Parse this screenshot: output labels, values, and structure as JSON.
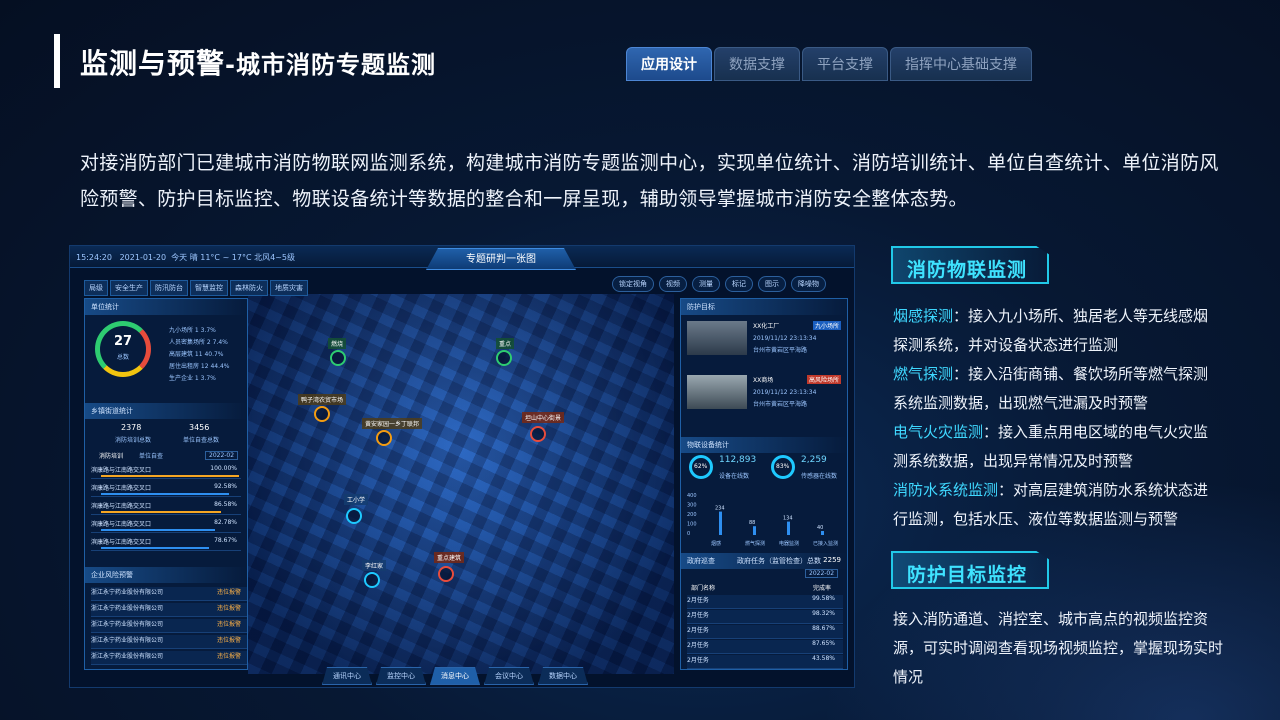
{
  "header": {
    "title_main": "监测与预警",
    "title_sub": "-城市消防专题监测"
  },
  "tabs": [
    {
      "label": "应用设计",
      "active": true
    },
    {
      "label": "数据支撑",
      "active": false
    },
    {
      "label": "平台支撑",
      "active": false
    },
    {
      "label": "指挥中心基础支撑",
      "active": false
    }
  ],
  "intro": "对接消防部门已建城市消防物联网监测系统，构建城市消防专题监测中心，实现单位统计、消防培训统计、单位自查统计、单位消防风险预警、防护目标监控、物联设备统计等数据的整合和一屏呈现，辅助领导掌握城市消防安全整体态势。",
  "dashboard": {
    "time": "15:24:20",
    "date": "2021-01-20",
    "weather": "今天 晴 11°C ~ 17°C 北风4~5级",
    "title": "专题研判一张图",
    "nav": [
      "局级",
      "安全生产",
      "防汛防台",
      "智慧监控",
      "森林防火",
      "地质灾害"
    ],
    "tools": [
      "锁定视角",
      "视频",
      "测量",
      "标记",
      "图示",
      "降噪物"
    ],
    "left": {
      "unit_stats_title": "单位统计",
      "ring_value": "27",
      "ring_label": "总数",
      "legend": [
        "九小场所 1 3.7%",
        "人员密集场所 2 7.4%",
        "高层建筑 11 40.7%",
        "居住出租房 12 44.4%",
        "生产企业 1 3.7%"
      ],
      "training_title": "乡镇街道统计",
      "training_count": "2378",
      "training_count_label": "消防培训总数",
      "self_check_count": "3456",
      "self_check_label": "单位自查总数",
      "training_tabs": [
        "消防培训",
        "单位自查"
      ],
      "year": "2022-02",
      "rows": [
        {
          "name": "滨康路与江南路交叉口",
          "value": "100.00%",
          "pct": 100
        },
        {
          "name": "滨康路与江南路交叉口",
          "value": "92.58%",
          "pct": 92.58
        },
        {
          "name": "滨康路与江南路交叉口",
          "value": "86.58%",
          "pct": 86.58
        },
        {
          "name": "滨康路与江南路交叉口",
          "value": "82.78%",
          "pct": 82.78
        },
        {
          "name": "滨康路与江南路交叉口",
          "value": "78.67%",
          "pct": 78.67
        }
      ],
      "risk_title": "企业风险预警",
      "risk_rows": [
        "浙江永宁药业股份有限公司",
        "浙江永宁药业股份有限公司",
        "浙江永宁药业股份有限公司",
        "浙江永宁药业股份有限公司",
        "浙江永宁药业股份有限公司"
      ],
      "risk_action": "违位报警"
    },
    "right": {
      "target_title": "防护目标",
      "targets": [
        {
          "name": "XX化工厂",
          "tag": "九小场所",
          "time": "2019/11/12 23:13:34",
          "addr": "台州市黄岩区平海路"
        },
        {
          "name": "XX商场",
          "tag": "高风险场所",
          "time": "2019/11/12 23:13:34",
          "addr": "台州市黄岩区平海路"
        }
      ],
      "iot_title": "物联设备统计",
      "iot_a_pct": "62%",
      "iot_a_value": "112,893",
      "iot_a_label": "设备在线数",
      "iot_b_pct": "83%",
      "iot_b_value": "2,259",
      "iot_b_label": "传感器在线数",
      "bars": [
        234,
        88,
        134,
        40
      ],
      "bar_labels": [
        "烟感",
        "燃气探测",
        "电器监测",
        "已接入监测"
      ],
      "y_ticks": [
        "400",
        "300",
        "200",
        "100",
        "0"
      ],
      "patrol_title": "政府巡查",
      "patrol_total_label": "政府任务（监管检查）总数",
      "patrol_total": "2259",
      "patrol_year": "2022-02",
      "patrol_head": [
        "部门名称",
        "完成率"
      ],
      "patrol_rows": [
        {
          "name": "2月任务",
          "rate": "99.58%"
        },
        {
          "name": "2月任务",
          "rate": "98.32%"
        },
        {
          "name": "2月任务",
          "rate": "88.67%"
        },
        {
          "name": "2月任务",
          "rate": "87.65%"
        },
        {
          "name": "2月任务",
          "rate": "43.58%"
        }
      ]
    },
    "pins": [
      "燃烧",
      "重点",
      "鸭子湾农贸市场",
      "黄安家园一乡丁联邦",
      "坦山中心街景",
      "工小学",
      "重点建筑",
      "李红家"
    ],
    "bottom_nav": [
      "通讯中心",
      "监控中心",
      "消息中心",
      "会议中心",
      "数据中心"
    ]
  },
  "side": {
    "section1_title": "消防物联监测",
    "items": [
      {
        "key": "烟感探测",
        "text": "：接入九小场所、独居老人等无线感烟探测系统，并对设备状态进行监测"
      },
      {
        "key": "燃气探测",
        "text": "：接入沿街商铺、餐饮场所等燃气探测系统监测数据，出现燃气泄漏及时预警"
      },
      {
        "key": "电气火灾监测",
        "text": "：接入重点用电区域的电气火灾监测系统数据，出现异常情况及时预警"
      },
      {
        "key": "消防水系统监测",
        "text": "：对高层建筑消防水系统状态进行监测，包括水压、液位等数据监测与预警"
      }
    ],
    "section2_title": "防护目标监控",
    "section2_text": "接入消防通道、消控室、城市高点的视频监控资源，可实时调阅查看现场视频监控，掌握现场实时情况"
  }
}
